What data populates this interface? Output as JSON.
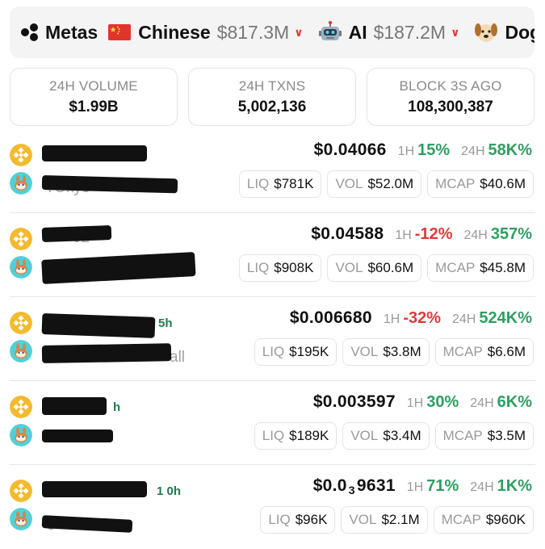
{
  "metas": {
    "title": "Metas",
    "chips": [
      {
        "emoji": "china-flag-icon",
        "name": "Chinese",
        "value": "$817.3M"
      },
      {
        "emoji": "robot-icon",
        "name": "AI",
        "value": "$187.2M"
      },
      {
        "emoji": "dog-icon",
        "name": "Dog",
        "value": ""
      }
    ]
  },
  "stats": [
    {
      "label": "24H VOLUME",
      "value": "$1.99B"
    },
    {
      "label": "24H TXNS",
      "value": "5,002,136"
    },
    {
      "label": "BLOCK 3S AGO",
      "value": "108,300,387"
    }
  ],
  "labels": {
    "h1": "1H",
    "h24": "24H",
    "liq": "LIQ",
    "vol": "VOL",
    "mcap": "MCAP"
  },
  "tokens": [
    {
      "price": "$0.04066",
      "h1": "15%",
      "h1_dir": "up",
      "h24": "58K%",
      "h24_dir": "up",
      "liq": "$781K",
      "vol": "$52.0M",
      "mcap": "$40.6M",
      "ghost_name": "",
      "ghost_age": "",
      "ghost_sub": "TOkyo"
    },
    {
      "price": "$0.04588",
      "h1": "-12%",
      "h1_dir": "down",
      "h24": "357%",
      "h24_dir": "up",
      "liq": "$908K",
      "vol": "$60.6M",
      "mcap": "$45.8M",
      "ghost_name": "02",
      "ghost_age": "",
      "ghost_sub": "Ti    ll"
    },
    {
      "price": "$0.006680",
      "h1": "-32%",
      "h1_dir": "down",
      "h24": "524K%",
      "h24_dir": "up",
      "liq": "$195K",
      "vol": "$3.8M",
      "mcap": "$6.6M",
      "ghost_name": "",
      "ghost_age": "5h",
      "ghost_sub": "all"
    },
    {
      "price_main": "$0.003597",
      "price": "$0.003597",
      "h1": "30%",
      "h1_dir": "up",
      "h24": "6K%",
      "h24_dir": "up",
      "liq": "$189K",
      "vol": "$3.4M",
      "mcap": "$3.5M",
      "ghost_name": "",
      "ghost_age": "h",
      "ghost_sub": "A"
    },
    {
      "price_pre": "$0.0",
      "price_sub": "3",
      "price_post": "9631",
      "h1": "71%",
      "h1_dir": "up",
      "h24": "1K%",
      "h24_dir": "up",
      "liq": "$96K",
      "vol": "$2.1M",
      "mcap": "$960K",
      "ghost_name": "",
      "ghost_age": "1 0h",
      "ghost_sub": "C"
    }
  ]
}
